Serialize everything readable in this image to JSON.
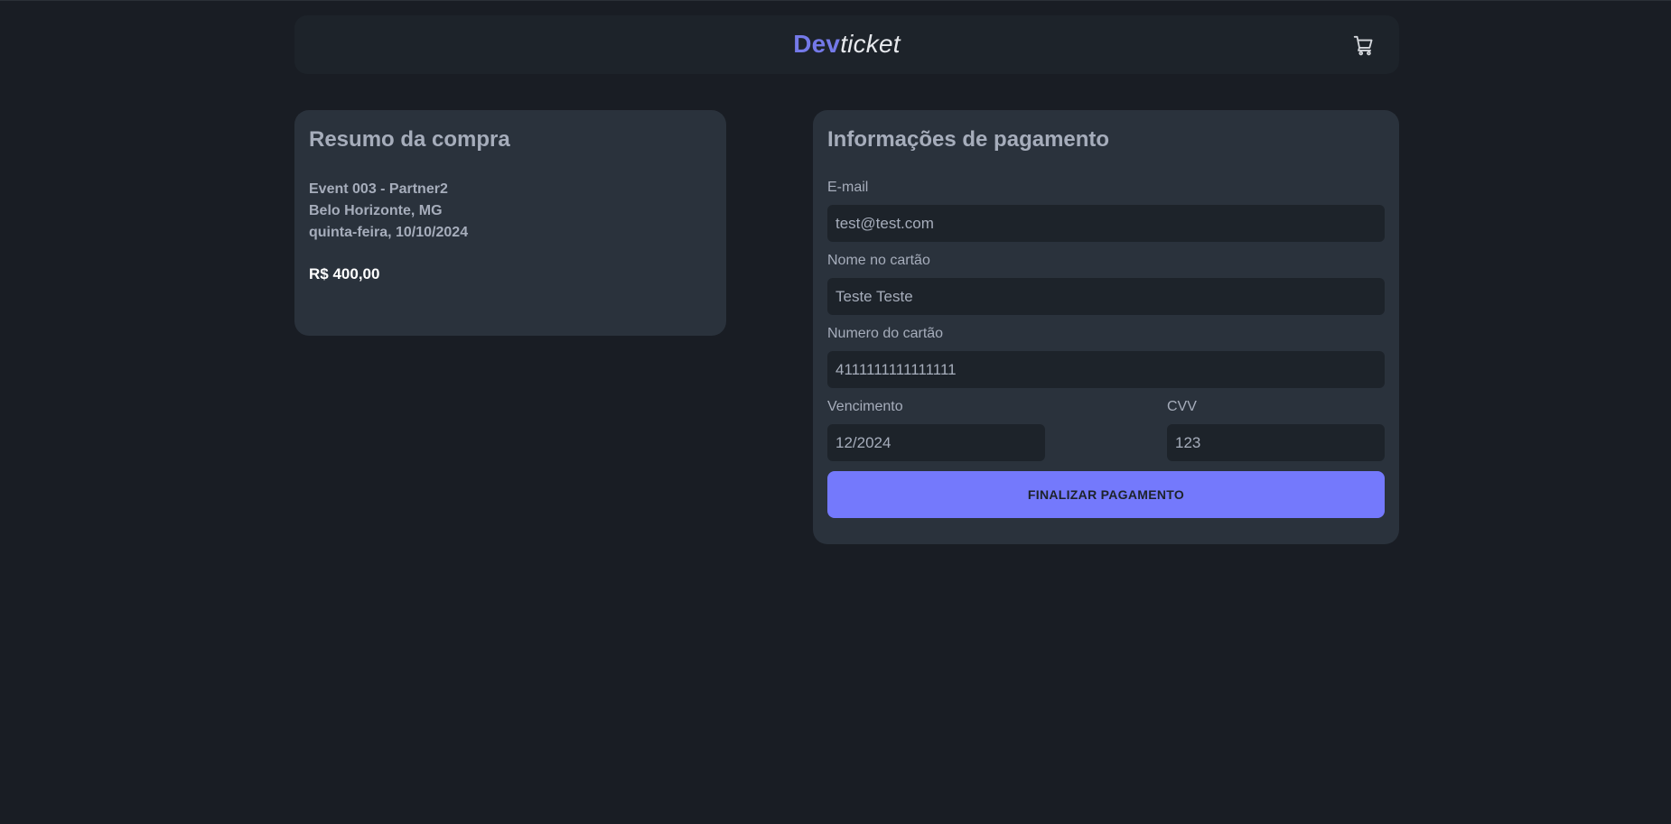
{
  "header": {
    "logo_part1": "Dev",
    "logo_part2": "ticket",
    "cart_icon": "cart-icon"
  },
  "summary": {
    "title": "Resumo da compra",
    "event_name": "Event 003 - Partner2",
    "location": "Belo Horizonte, MG",
    "date": "quinta-feira, 10/10/2024",
    "price": "R$ 400,00"
  },
  "payment": {
    "title": "Informações de pagamento",
    "email": {
      "label": "E-mail",
      "value": "test@test.com"
    },
    "card_name": {
      "label": "Nome no cartão",
      "value": "Teste Teste"
    },
    "card_number": {
      "label": "Numero do cartão",
      "value": "4111111111111111"
    },
    "expiry": {
      "label": "Vencimento",
      "value": "12/2024"
    },
    "cvv": {
      "label": "CVV",
      "value": "123"
    },
    "submit_label": "FINALIZAR PAGAMENTO"
  },
  "colors": {
    "background": "#191d24",
    "card": "#2a323c",
    "input": "#1d232a",
    "accent": "#7479fc",
    "logo_accent": "#7479e8"
  }
}
